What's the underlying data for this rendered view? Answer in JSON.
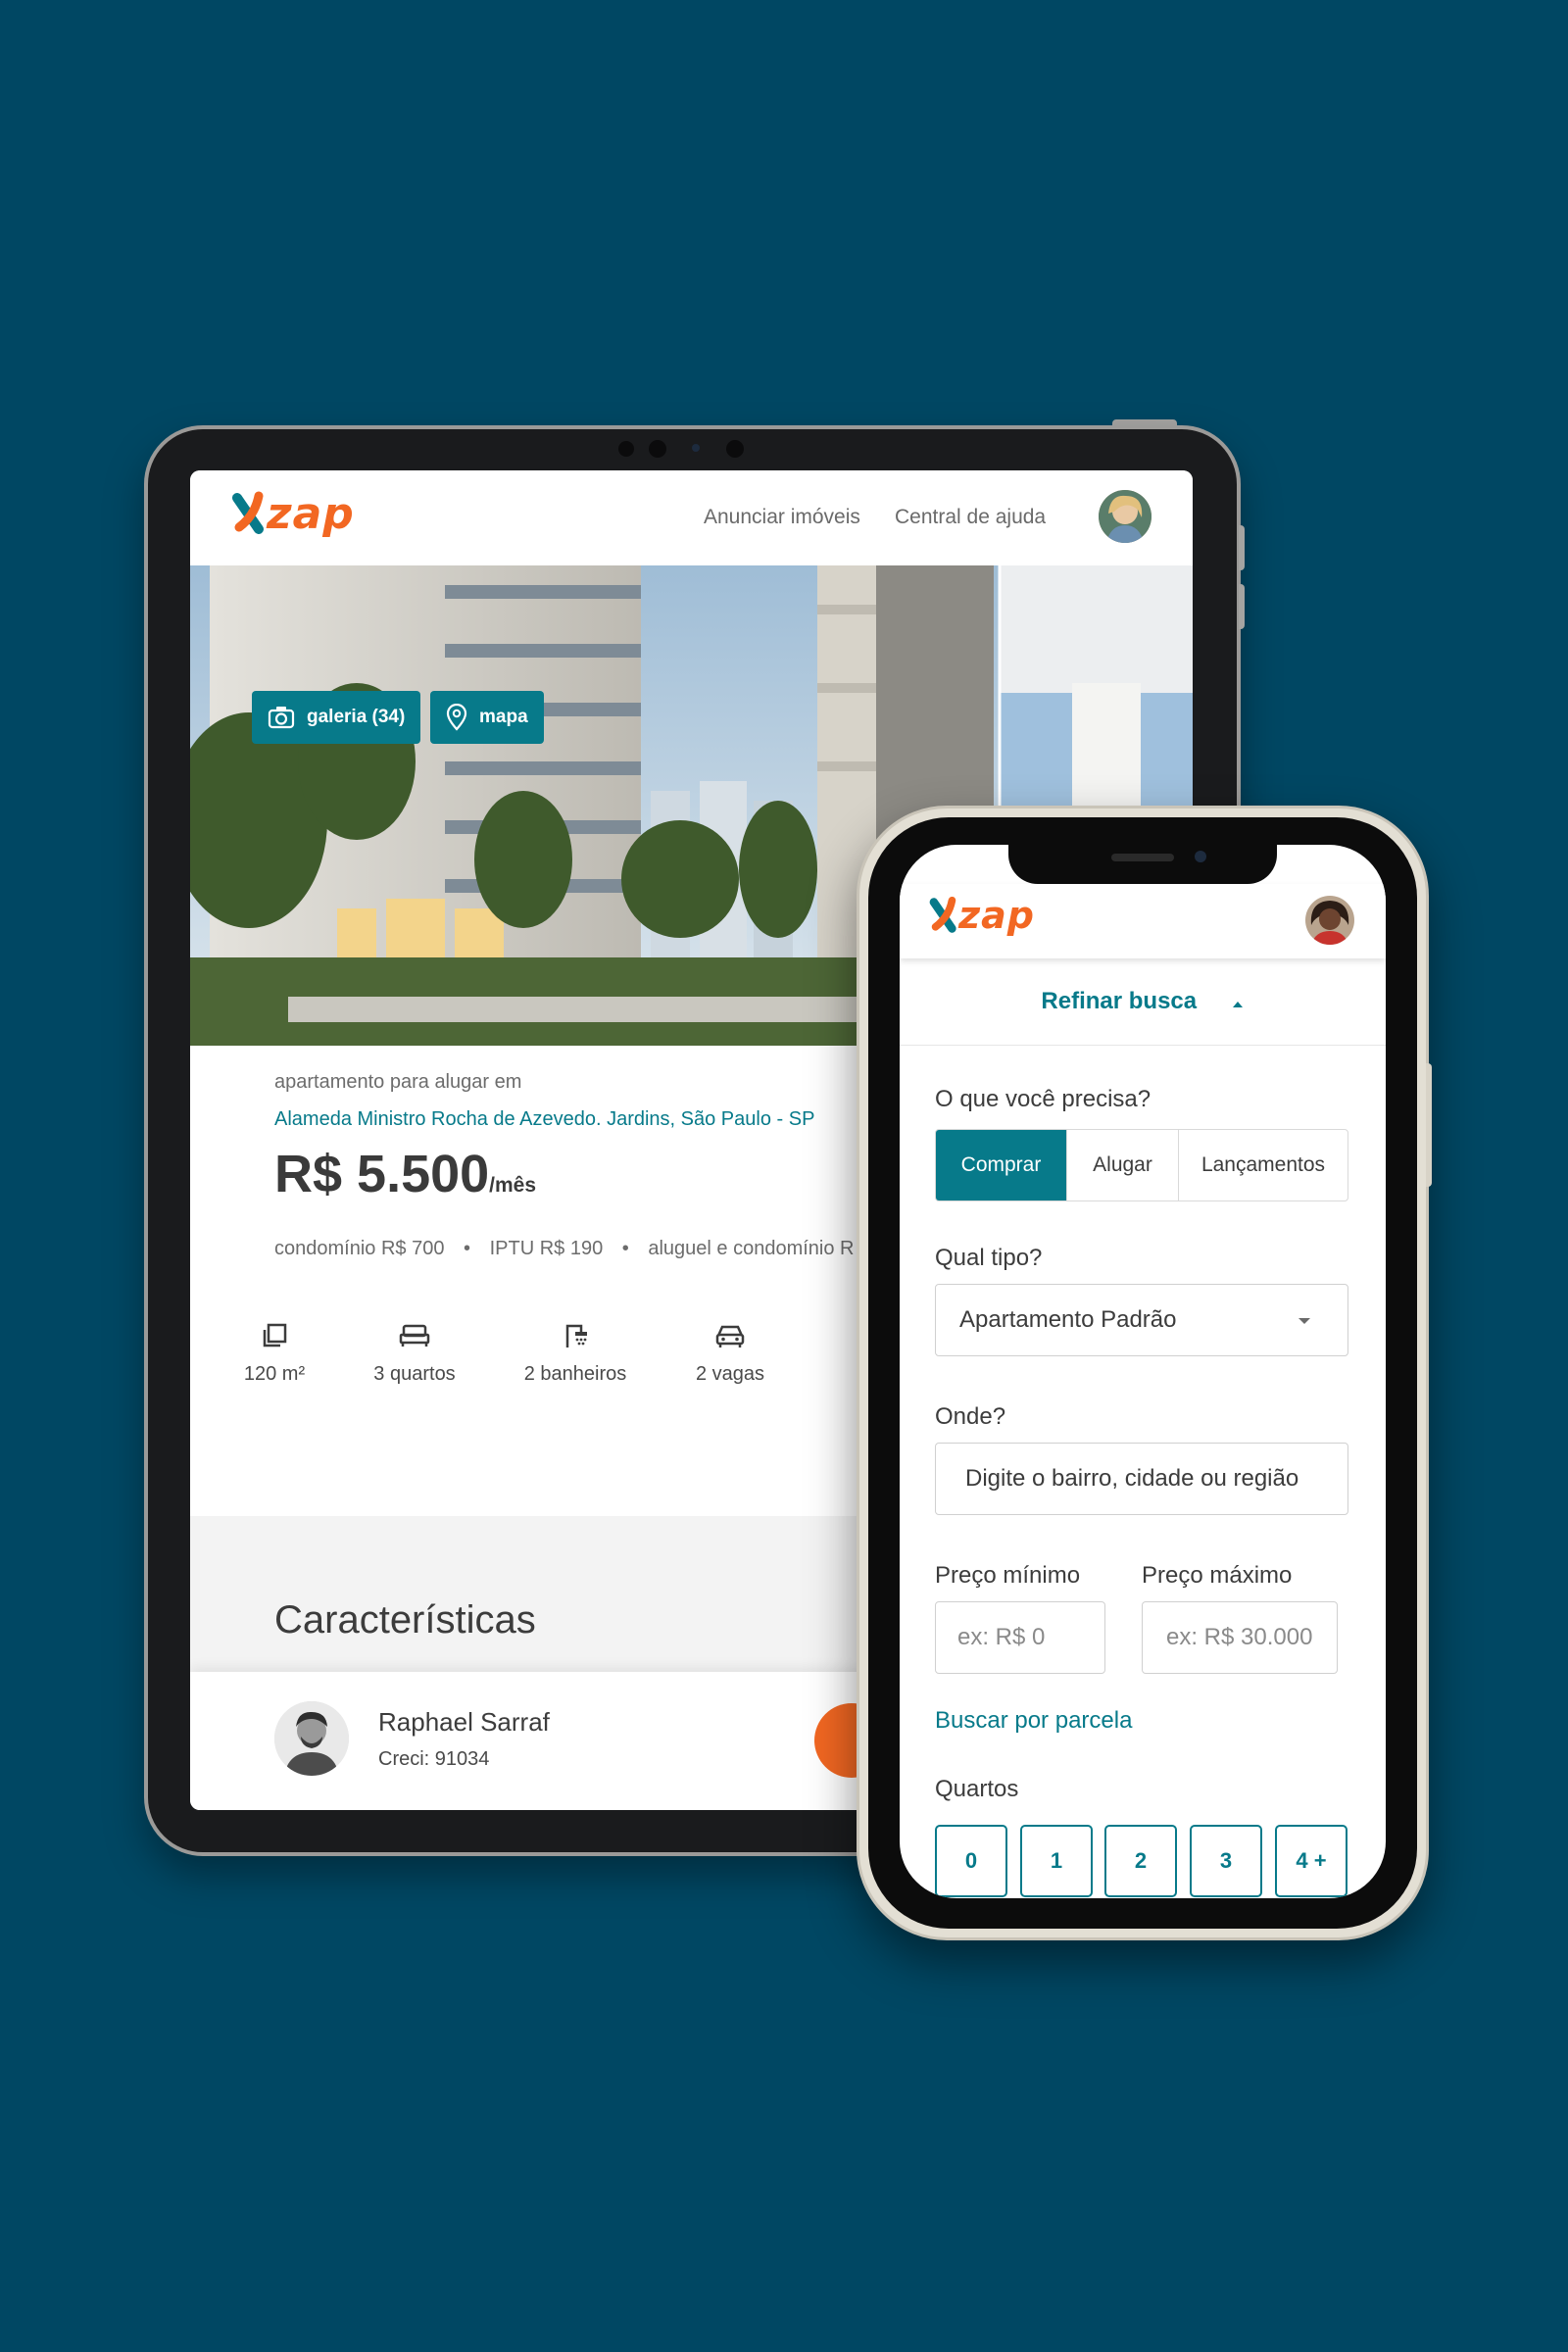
{
  "brand": {
    "logo_text": "zap",
    "accent": "#f26722",
    "primary": "#077a8a",
    "background": "#004763"
  },
  "tablet": {
    "nav": {
      "advertise": "Anunciar imóveis",
      "help": "Central de ajuda"
    },
    "photo": {
      "gallery": "galeria (34)",
      "map": "mapa"
    },
    "listing": {
      "kind": "apartamento para alugar em",
      "address": "Alameda Ministro Rocha de Azevedo. Jardins, São Paulo - SP",
      "price": "R$ 5.500",
      "price_unit": "/mês",
      "fees": [
        {
          "label": "condomínio R$ 700"
        },
        {
          "label": "IPTU R$ 190"
        },
        {
          "label": "aluguel e condomínio R"
        }
      ],
      "bullet": "•",
      "features": [
        {
          "icon": "area-icon",
          "label": "120 m²"
        },
        {
          "icon": "bed-icon",
          "label": "3 quartos"
        },
        {
          "icon": "shower-icon",
          "label": "2 banheiros"
        },
        {
          "icon": "car-icon",
          "label": "2 vagas"
        }
      ]
    },
    "section_title": "Características",
    "agent": {
      "name": "Raphael Sarraf",
      "creci": "Creci: 91034"
    }
  },
  "phone": {
    "refine": "Refinar busca",
    "need_label": "O que você precisa?",
    "need_options": [
      "Comprar",
      "Alugar",
      "Lançamentos"
    ],
    "need_selected": "Comprar",
    "type_label": "Qual tipo?",
    "type_value": "Apartamento Padrão",
    "where_label": "Onde?",
    "where_placeholder": "Digite o bairro, cidade ou região",
    "min_label": "Preço mínimo",
    "min_placeholder": "ex: R$ 0",
    "max_label": "Preço máximo",
    "max_placeholder": "ex: R$ 30.000",
    "installment_link": "Buscar por parcela",
    "rooms_label": "Quartos",
    "rooms": [
      "0",
      "1",
      "2",
      "3",
      "4 +"
    ]
  }
}
